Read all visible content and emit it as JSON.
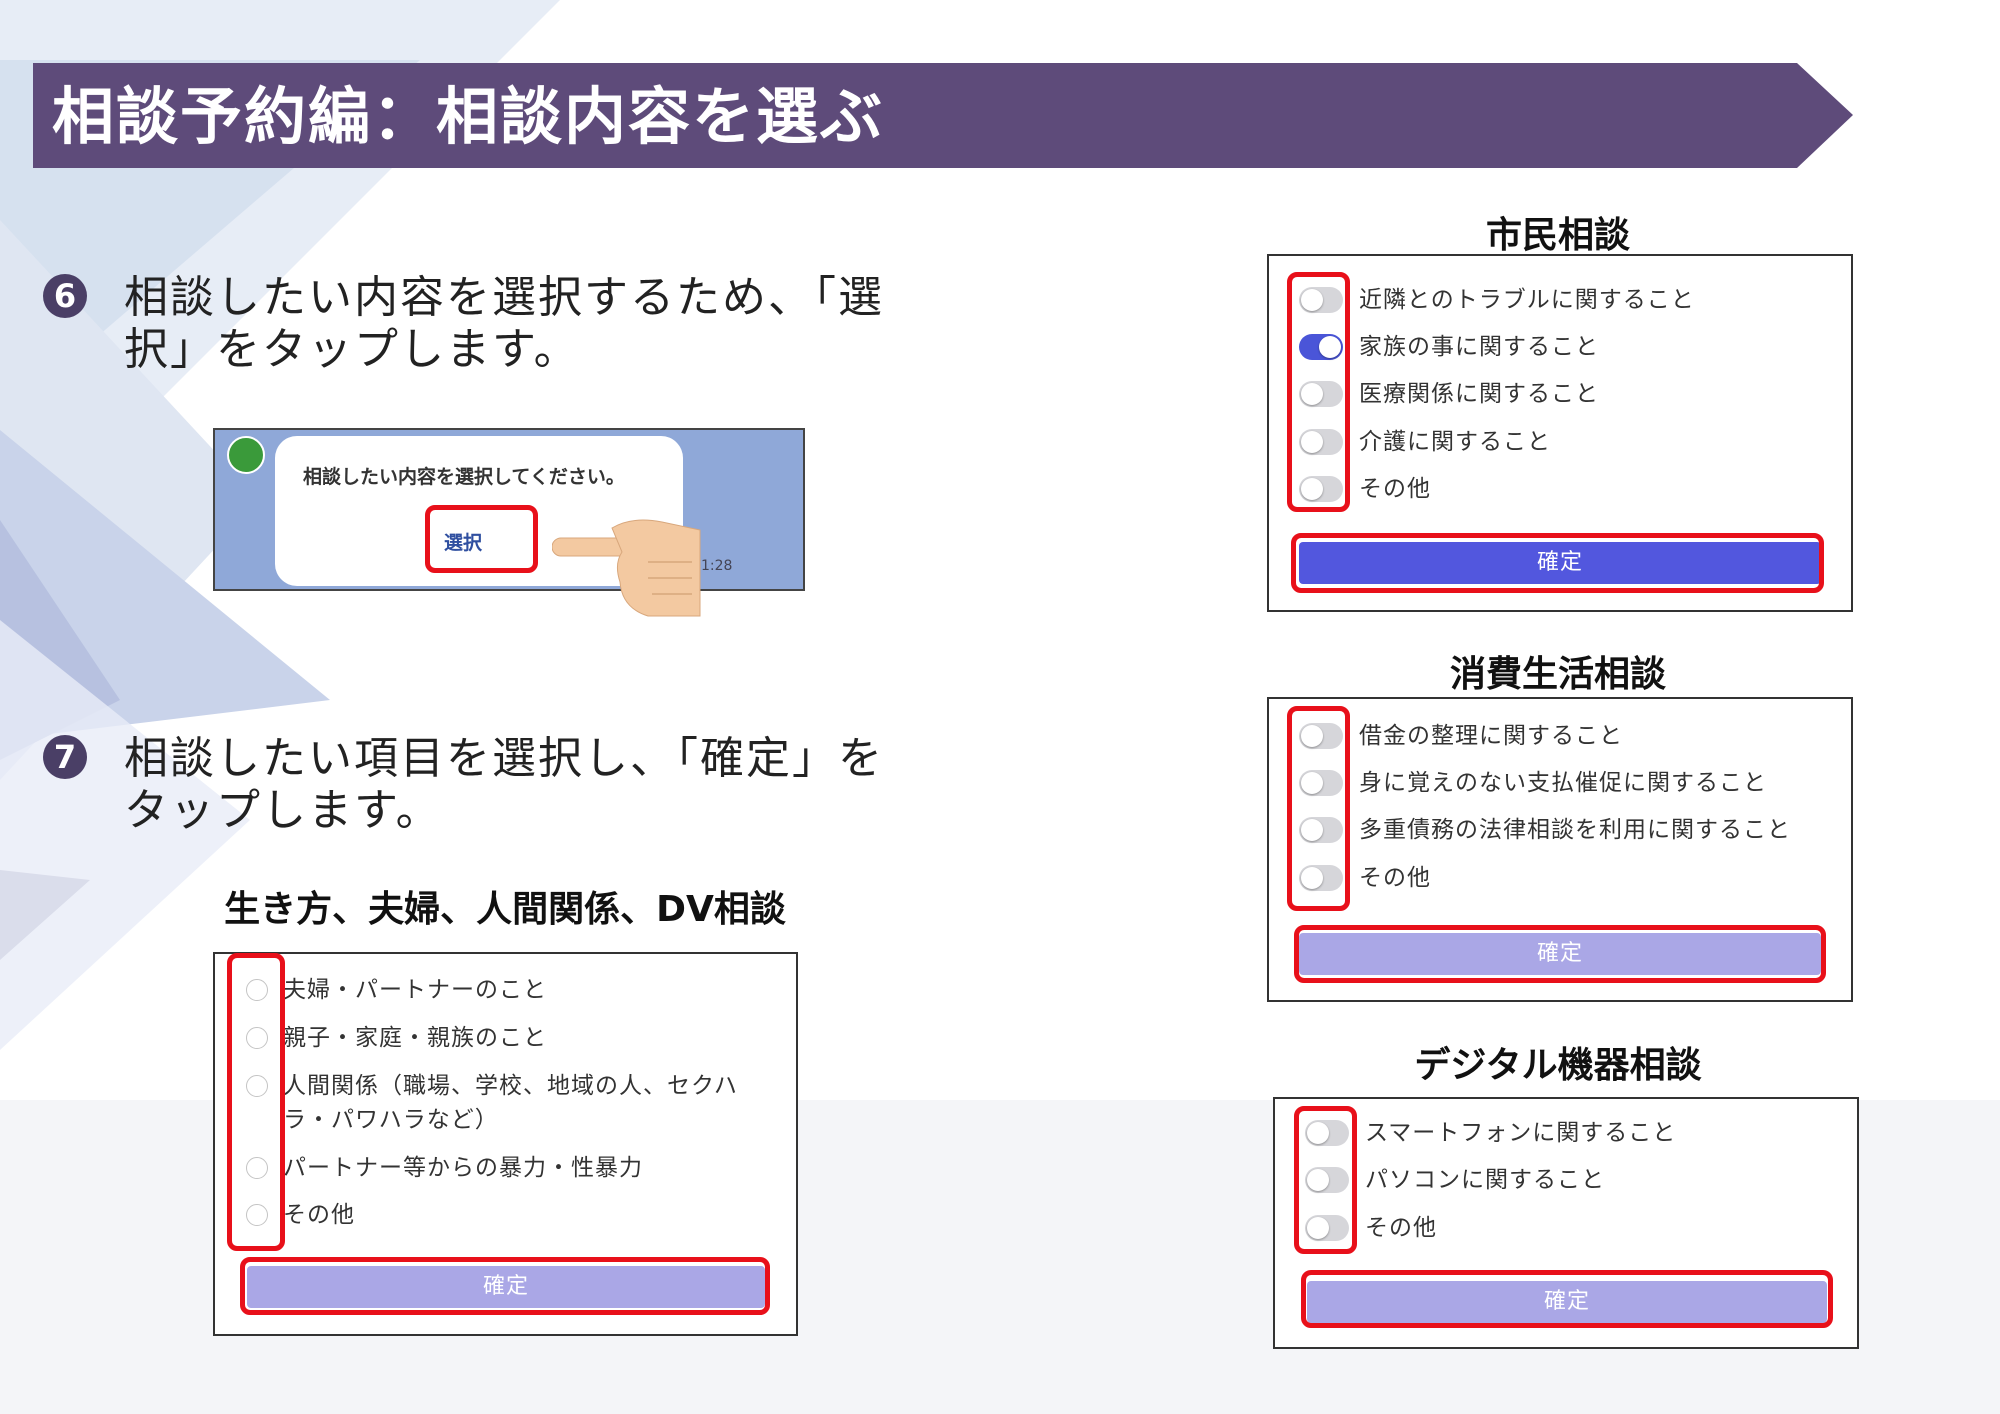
{
  "header": {
    "title": "相談予約編：相談内容を選ぶ"
  },
  "steps": [
    {
      "badge": "6",
      "line1": "相談したい内容を選択するため、「選",
      "line2": "択」をタップします。"
    },
    {
      "badge": "7",
      "line1": "相談したい項目を選択し、「確定」を",
      "line2": "タップします。"
    }
  ],
  "chat_preview": {
    "message": "相談したい内容を選択してください。",
    "select_label": "選択",
    "time": "1:28"
  },
  "panels": {
    "ikikata": {
      "title": "生き方、夫婦、人間関係、DV相談",
      "items": [
        "夫婦・パートナーのこと",
        "親子・家庭・親族のこと",
        "人間関係（職場、学校、地域の人、セクハ",
        "ラ・パワハラなど）",
        "パートナー等からの暴力・性暴力",
        "その他"
      ],
      "confirm": "確定"
    },
    "shimin": {
      "title": "市民相談",
      "items": [
        "近隣とのトラブルに関すること",
        "家族の事に関すること",
        "医療関係に関すること",
        "介護に関すること",
        "その他"
      ],
      "confirm": "確定"
    },
    "shohi": {
      "title": "消費生活相談",
      "items": [
        "借金の整理に関すること",
        "身に覚えのない支払催促に関すること",
        "多重債務の法律相談を利用に関すること",
        "その他"
      ],
      "confirm": "確定"
    },
    "digital": {
      "title": "デジタル機器相談",
      "items": [
        "スマートフォンに関すること",
        "パソコンに関すること",
        "その他"
      ],
      "confirm": "確定"
    }
  },
  "colors": {
    "title_bar": "#5e4b7a",
    "toggle_on": "#4a55d8",
    "confirm_active": "#5257de",
    "confirm_inactive": "#aaa7e6",
    "highlight": "#e8101a"
  }
}
